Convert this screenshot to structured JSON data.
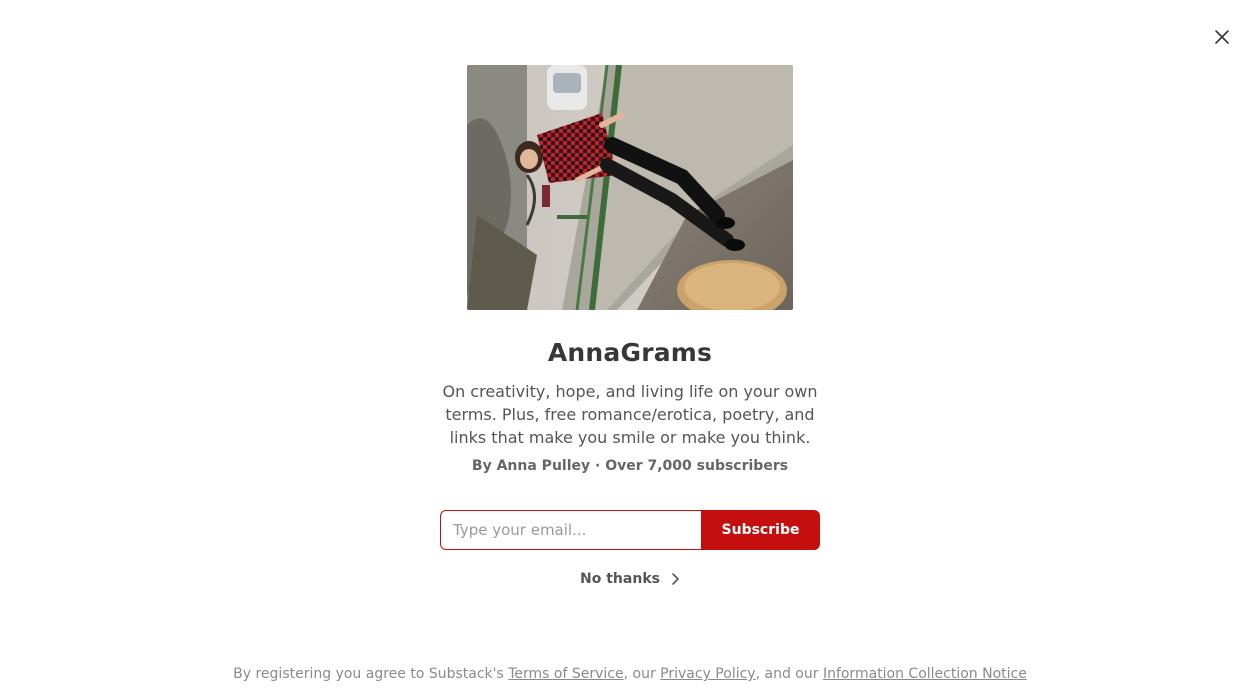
{
  "modal": {
    "close_icon": "close-icon"
  },
  "hero_image": {
    "alt": "Photo of a woman in a red plaid shirt leaning on a railing"
  },
  "publication": {
    "title": "AnnaGrams",
    "description": "On creativity, hope, and living life on your own terms. Plus, free romance/erotica, poetry, and links that make you smile or make you think.",
    "byline": "By Anna Pulley · Over 7,000 subscribers"
  },
  "subscribe_form": {
    "email_placeholder": "Type your email...",
    "subscribe_label": "Subscribe"
  },
  "no_thanks": {
    "label": "No thanks",
    "icon": "chevron-right-icon"
  },
  "footer": {
    "prefix": "By registering you agree to Substack's ",
    "terms_label": "Terms of Service",
    "sep1": ", our ",
    "privacy_label": "Privacy Policy",
    "sep2": ", and our ",
    "collection_label": "Information Collection Notice"
  },
  "colors": {
    "accent": "#c50f0f",
    "text": "#363737",
    "muted": "#8a8a8a"
  }
}
